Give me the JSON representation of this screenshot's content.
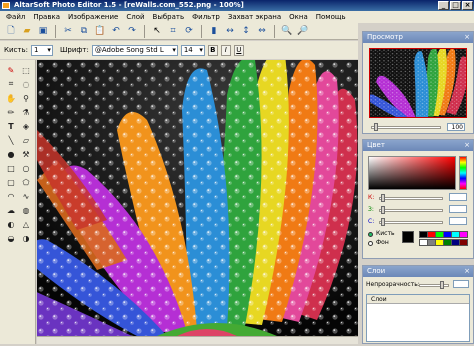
{
  "window": {
    "title": "AltarSoft Photo Editor 1.5 - [reWalls.com_552.png - 100%]"
  },
  "menu": [
    "Файл",
    "Правка",
    "Изображение",
    "Слой",
    "Выбрать",
    "Фильтр",
    "Захват экрана",
    "Окна",
    "Помощь"
  ],
  "options": {
    "brush_label": "Кисть:",
    "brush_value": "1",
    "font_label": "Шрифт:",
    "font_value": "@Adobe Song Std L",
    "size_value": "14",
    "bold": "B",
    "italic": "I",
    "underline": "U"
  },
  "preview": {
    "title": "Просмотр",
    "zoom_value": "100"
  },
  "color": {
    "title": "Цвет",
    "k_label": "К:",
    "z_label": "З:",
    "s_label": "С:",
    "brush_radio": "Кисть",
    "bg_radio": "Фон",
    "palette": [
      "#000000",
      "#ff0000",
      "#00ff00",
      "#0000ff",
      "#00ffff",
      "#ff00ff",
      "#ffffff",
      "#808080",
      "#ffff00",
      "#008000",
      "#000080",
      "#800000"
    ]
  },
  "layers": {
    "title": "Слои",
    "opacity_label": "Непрозрачность:",
    "list_header": "Слои"
  }
}
